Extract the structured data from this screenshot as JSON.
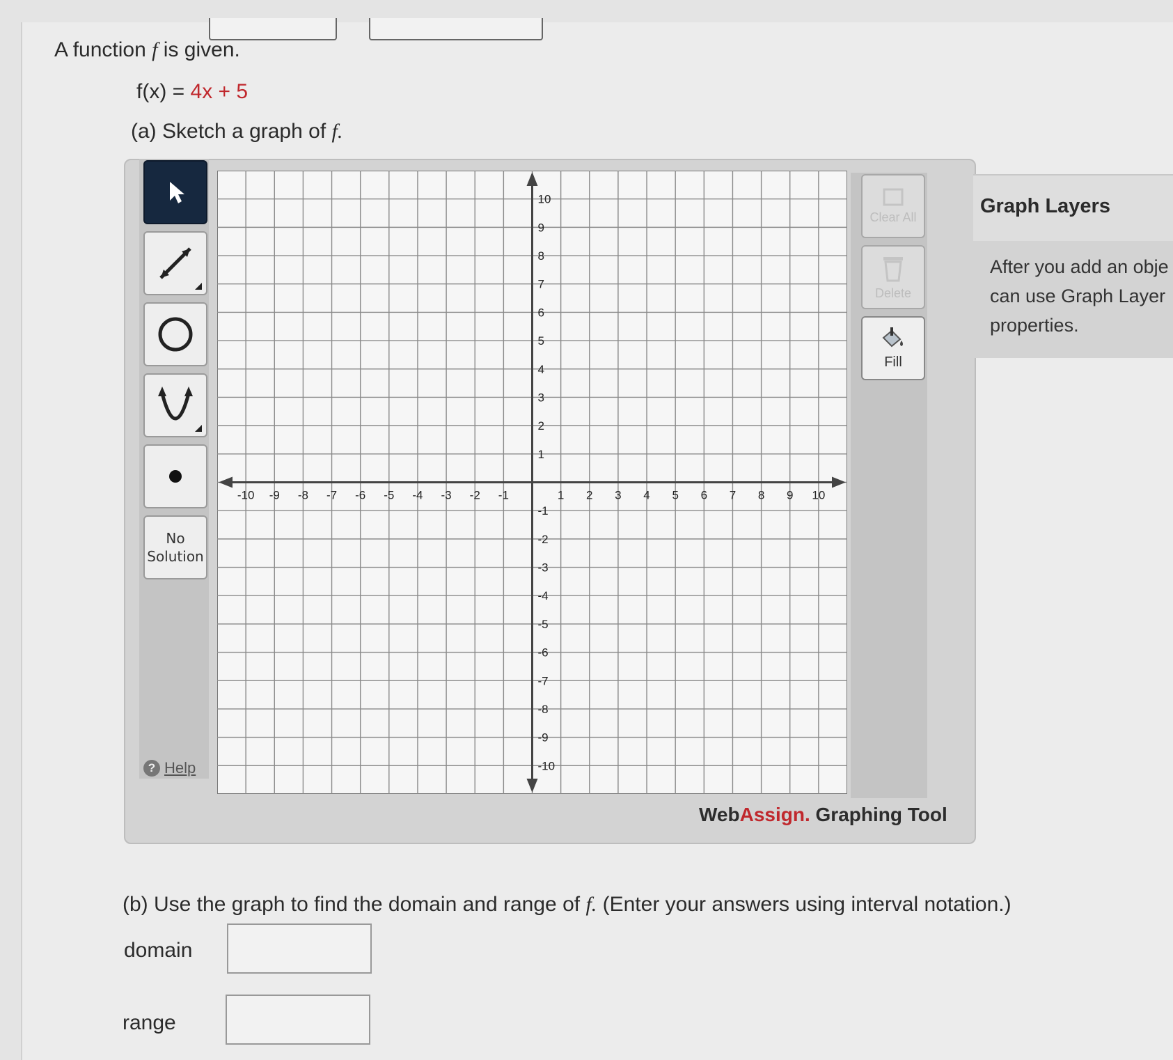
{
  "question": {
    "intro": "A function",
    "intro_var": "f",
    "intro_end": "is given.",
    "function_lhs": "f(x) =",
    "function_rhs": "4x + 5",
    "part_a": "(a) Sketch a graph of",
    "part_a_var": "f.",
    "part_b": "(b) Use the graph to find the domain and range of",
    "part_b_var": "f.",
    "part_b_end": "(Enter your answers using interval notation.)"
  },
  "tool": {
    "no_solution_line1": "No",
    "no_solution_line2": "Solution",
    "help_label": "Help",
    "clear_all_label": "Clear All",
    "delete_label": "Delete",
    "fill_label": "Fill",
    "brand_web": "Web",
    "brand_assign": "Assign.",
    "brand_tool": "Graphing Tool",
    "icons": [
      "pointer-icon",
      "line-icon",
      "circle-icon",
      "parabola-icon",
      "point-icon",
      "trash-icon",
      "paint-bucket-icon",
      "help-icon"
    ]
  },
  "graph": {
    "x_range": [
      -10,
      10
    ],
    "y_range": [
      -10,
      10
    ],
    "x_tick_labels": [
      "-10",
      "-9",
      "-8",
      "-7",
      "-6",
      "-5",
      "-4",
      "-3",
      "-2",
      "-1",
      "1",
      "2",
      "3",
      "4",
      "5",
      "6",
      "7",
      "8",
      "9",
      "10"
    ],
    "y_tick_labels": [
      "10",
      "9",
      "8",
      "7",
      "6",
      "5",
      "4",
      "3",
      "2",
      "1",
      "-1",
      "-2",
      "-3",
      "-4",
      "-5",
      "-6",
      "-7",
      "-8",
      "-9",
      "-10"
    ],
    "grid": true
  },
  "layers": {
    "title": "Graph Layers",
    "line1": "After you add an obje",
    "line2": "can use Graph Layer",
    "line3": "properties."
  },
  "answers": {
    "domain_label": "domain",
    "domain_value": "",
    "range_label": "range",
    "range_value": ""
  }
}
